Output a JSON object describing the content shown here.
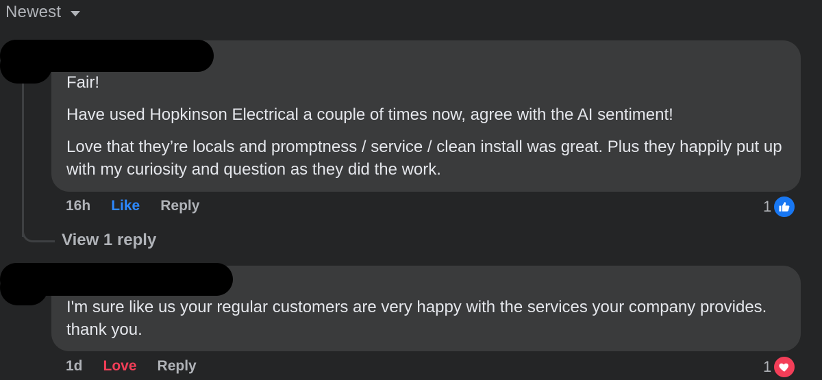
{
  "sort": {
    "label": "Newest"
  },
  "comments": [
    {
      "paragraphs": [
        "Fair!",
        "Have used Hopkinson Electrical a couple of times now, agree with the AI sentiment!",
        "Love that they’re locals and promptness / service / clean install was great. Plus they happily put up with my curiosity and question as they did the work."
      ],
      "time": "16h",
      "reaction_label": "Like",
      "reply_label": "Reply",
      "reaction_count": "1",
      "reaction_icon": "thumbs-up-icon",
      "reaction_color": "#1877f2",
      "label_color": "#2d88ff"
    },
    {
      "paragraphs": [
        "I'm sure like us your regular customers are very happy with the services your company provides. thank you."
      ],
      "time": "1d",
      "reaction_label": "Love",
      "reply_label": "Reply",
      "reaction_count": "1",
      "reaction_icon": "heart-icon",
      "reaction_color": "#f33e58",
      "label_color": "#f33e58"
    }
  ],
  "view_replies": {
    "label": "View 1 reply"
  }
}
